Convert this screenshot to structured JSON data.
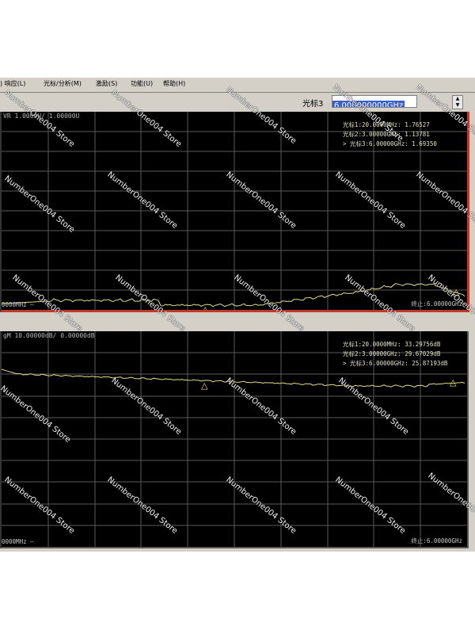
{
  "menu": {
    "items": [
      ") 响应(L)",
      "光标/分析(M)",
      "激励(S)",
      "功能(U)",
      "帮助(H)"
    ]
  },
  "toolbar": {
    "marker_label": "光标3",
    "marker_value": "6.000000000GHz",
    "spin_up": "▲",
    "spin_down": "▼"
  },
  "plot1": {
    "header": "VR 1.0000U/ 1.00000U",
    "markers": [
      "光标1:20.0000MHz: 1.76527",
      "光标2:3.00000GHz: 1.13781",
      "> 光标3:6.00000GHz: 1.69350"
    ],
    "start": "0000MHz —",
    "stop": "终止:6.00000GHz",
    "marker_glyph": "△"
  },
  "plot2": {
    "header": "gM 10.00000dB/ 0.00000dB",
    "markers": [
      "光标1:20.0000MHz: 33.29756dB",
      "光标2:3.00000GHz: 29.67029dB",
      "> 光标3:6.00000GHz: 25.87193dB"
    ],
    "start": "0000MHz —",
    "stop": "终止:6.00000GHz",
    "marker_glyph": "△"
  },
  "colors": {
    "trace": "#e2dc8c",
    "grid": "#5a5a5a",
    "marker": "#e8e090",
    "active_border": "#c0392b"
  },
  "watermark": "NumberOne004 Store"
}
